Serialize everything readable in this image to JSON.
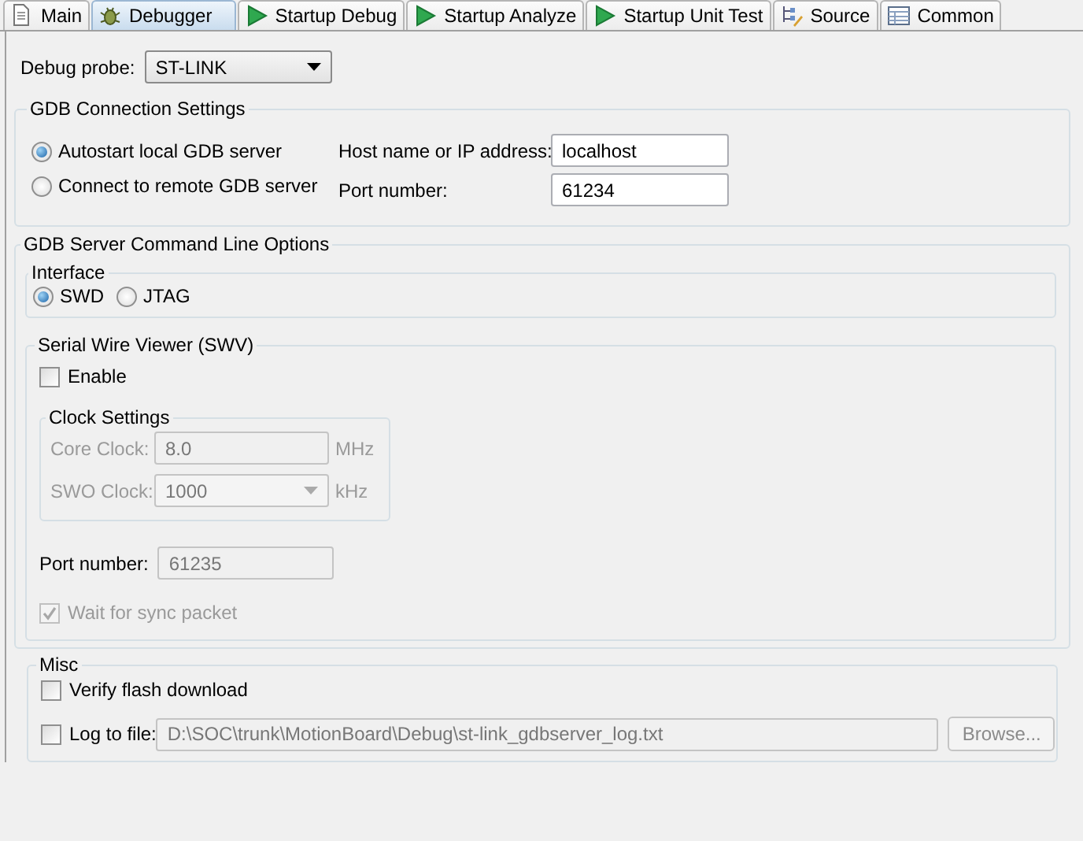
{
  "tabs": [
    {
      "label": "Main",
      "kind": "document",
      "selected": false
    },
    {
      "label": "Debugger",
      "kind": "bug",
      "selected": true
    },
    {
      "label": "Startup Debug",
      "kind": "play",
      "selected": false
    },
    {
      "label": "Startup Analyze",
      "kind": "play",
      "selected": false
    },
    {
      "label": "Startup Unit Test",
      "kind": "play",
      "selected": false
    },
    {
      "label": "Source",
      "kind": "source",
      "selected": false
    },
    {
      "label": "Common",
      "kind": "table",
      "selected": false
    }
  ],
  "debug_probe": {
    "label": "Debug probe:",
    "value": "ST-LINK"
  },
  "gdb_connection": {
    "title": "GDB Connection Settings",
    "modes": [
      {
        "label": "Autostart local GDB server",
        "selected": true
      },
      {
        "label": "Connect to remote GDB server",
        "selected": false
      }
    ],
    "host": {
      "label": "Host name or IP address:",
      "value": "localhost"
    },
    "port": {
      "label": "Port number:",
      "value": "61234"
    }
  },
  "server_options": {
    "title": "GDB Server Command Line Options",
    "interface": {
      "title": "Interface",
      "options": [
        {
          "label": "SWD",
          "selected": true
        },
        {
          "label": "JTAG",
          "selected": false
        }
      ]
    },
    "swv": {
      "title": "Serial Wire Viewer (SWV)",
      "enable": {
        "label": "Enable",
        "checked": false
      },
      "clock_settings": {
        "title": "Clock Settings",
        "core_clock": {
          "label": "Core Clock:",
          "value": "8.0",
          "unit": "MHz",
          "disabled": true
        },
        "swo_clock": {
          "label": "SWO Clock:",
          "value": "1000",
          "unit": "kHz",
          "disabled": true
        }
      },
      "port": {
        "label": "Port number:",
        "value": "61235",
        "disabled": true
      },
      "wait_sync": {
        "label": "Wait for sync packet",
        "checked": true,
        "disabled": true
      }
    }
  },
  "misc": {
    "title": "Misc",
    "verify": {
      "label": "Verify flash download",
      "checked": false
    },
    "log": {
      "label": "Log to file:",
      "checked": false,
      "path": "D:\\SOC\\trunk\\MotionBoard\\Debug\\st-link_gdbserver_log.txt",
      "disabled": true,
      "browse": "Browse..."
    }
  }
}
